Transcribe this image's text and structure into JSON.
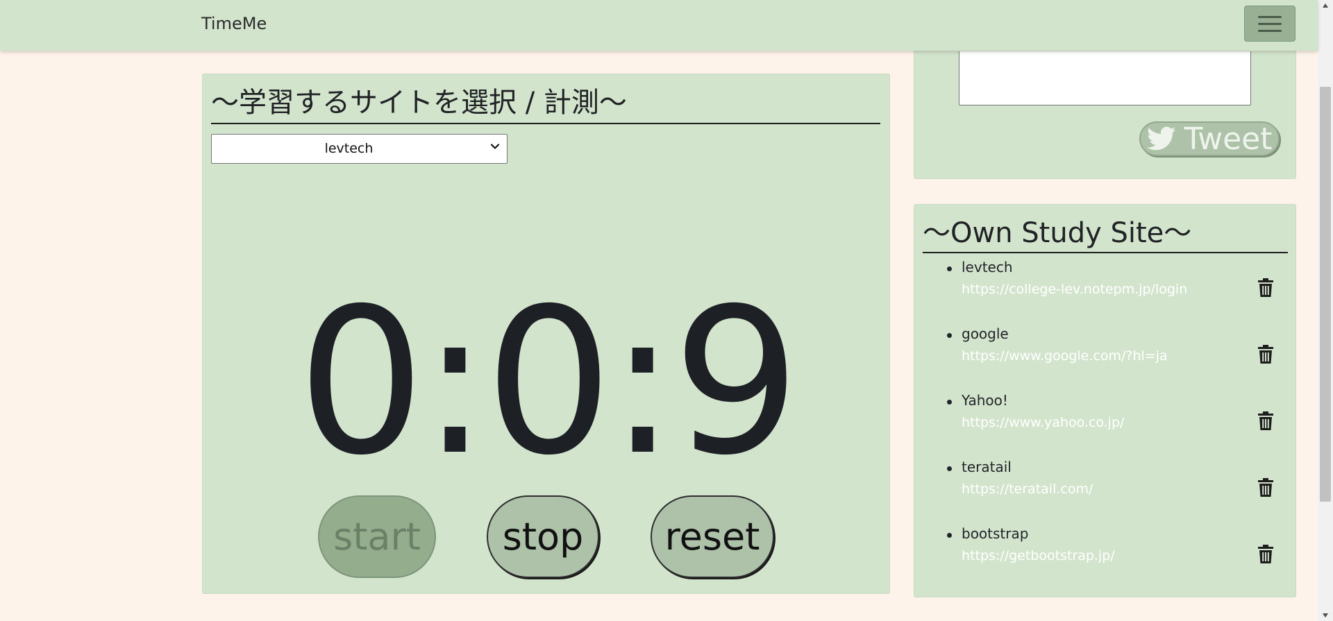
{
  "navbar": {
    "brand": "TimeMe",
    "menu_icon": "hamburger-menu-icon"
  },
  "timer": {
    "title": "〜学習するサイトを選択 / 計測〜",
    "selected_site": "levtech",
    "display": "0:0:9",
    "start_label": "start",
    "stop_label": "stop",
    "reset_label": "reset"
  },
  "tweet": {
    "textarea_value": "",
    "button_label": "Tweet",
    "icon": "twitter-bird-icon"
  },
  "own_sites": {
    "title": "〜Own Study Site〜",
    "items": [
      {
        "name": "levtech",
        "url": "https://college-lev.notepm.jp/login"
      },
      {
        "name": "google",
        "url": "https://www.google.com/?hl=ja"
      },
      {
        "name": "Yahoo!",
        "url": "https://www.yahoo.co.jp/"
      },
      {
        "name": "teratail",
        "url": "https://teratail.com/"
      },
      {
        "name": "bootstrap",
        "url": "https://getbootstrap.jp/"
      }
    ],
    "delete_icon": "trash-icon"
  },
  "colors": {
    "page_background": "#fdf3ea",
    "panel_background": "#d3e4cd",
    "button_background": "#adc2a9",
    "start_button_background": "#93ad8d"
  }
}
